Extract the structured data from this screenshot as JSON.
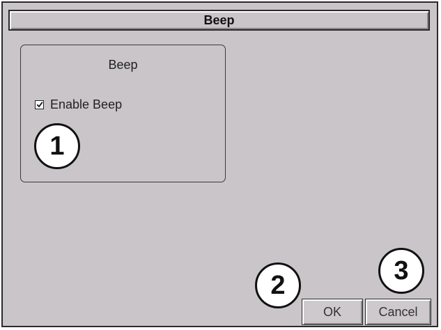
{
  "window": {
    "title": "Beep"
  },
  "group": {
    "title": "Beep",
    "checkbox_label": "Enable Beep",
    "checkbox_checked": true
  },
  "callouts": [
    "1",
    "2",
    "3"
  ],
  "buttons": {
    "ok_label": "OK",
    "cancel_label": "Cancel"
  },
  "colors": {
    "window_background": "#c9c5c8",
    "border": "#2a2a2a",
    "callout_fill": "#ffffff"
  },
  "icons": {
    "checkbox": "checkmark-icon"
  }
}
